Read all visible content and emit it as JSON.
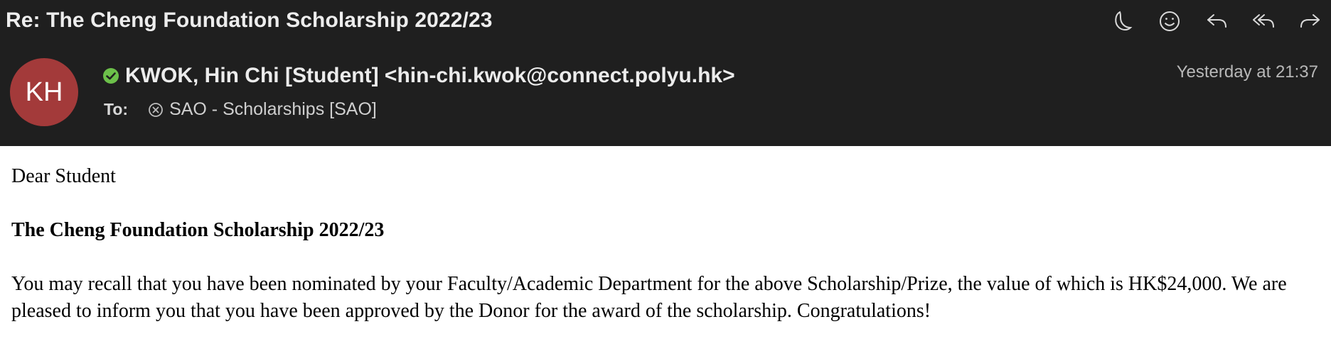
{
  "email": {
    "subject": "Re: The Cheng Foundation Scholarship 2022/23",
    "avatar_initials": "KH",
    "avatar_color": "#a33a3a",
    "verified_color": "#6cc04a",
    "sender": "KWOK, Hin Chi [Student] <hin-chi.kwok@connect.polyu.hk>",
    "to_label": "To:",
    "recipient": "SAO - Scholarships [SAO]",
    "date": "Yesterday at 21:37"
  },
  "toolbar": {
    "icons": [
      "moon-icon",
      "smiley-icon",
      "reply-icon",
      "reply-all-icon",
      "forward-icon"
    ]
  },
  "body": {
    "greeting": "Dear Student",
    "heading": "The Cheng Foundation Scholarship 2022/23",
    "paragraph": "You may recall that you have been nominated by your Faculty/Academic Department for the above Scholarship/Prize, the value of which is HK$24,000. We are pleased to inform you that you have been approved by the Donor for the award of the scholarship. Congratulations!"
  }
}
